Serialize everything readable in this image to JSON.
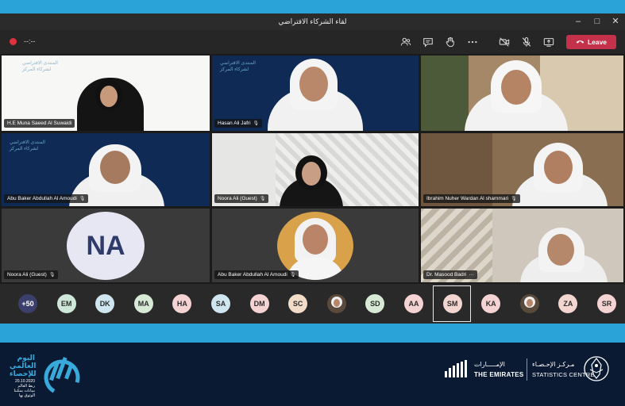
{
  "window": {
    "title": "لقاء الشركاء الافتراضي",
    "minimize": "–",
    "maximize": "□",
    "close": "✕"
  },
  "toolbar": {
    "timer": "--:--",
    "leave_label": "Leave"
  },
  "tiles": [
    {
      "name": "H.E Muna Saeed Al Suwaidi",
      "mic": false
    },
    {
      "name": "Hasan Ali Jafri",
      "mic": true
    },
    {
      "name": "",
      "mic": false
    },
    {
      "name": "Abu Baker Abdullah Al Amoudi",
      "mic": true
    },
    {
      "name": "Noora Ali (Guest)",
      "mic": true
    },
    {
      "name": "Ibrahim Nuher Wardan Al shammari",
      "mic": true
    },
    {
      "name": "Noora Ali (Guest)",
      "mic": true,
      "initials": "NA"
    },
    {
      "name": "Abu Baker Abdullah Al Amoudi",
      "mic": true
    },
    {
      "name": "Dr. Masood Badri",
      "more": "···"
    }
  ],
  "backdrop_text": {
    "line1": "المنتدى الافتراضي",
    "line2": "لشركاء المركز",
    "centre": "STATISTICS CENTRE"
  },
  "participants": [
    {
      "initials": "+50",
      "color": "#3b3f6b",
      "text_color": "#ffffff"
    },
    {
      "initials": "EM",
      "color": "#cde7d8"
    },
    {
      "initials": "DK",
      "color": "#cfe6f0"
    },
    {
      "initials": "MA",
      "color": "#d7ead6"
    },
    {
      "initials": "HA",
      "color": "#f6d3d3"
    },
    {
      "initials": "SA",
      "color": "#cfe6f0"
    },
    {
      "initials": "DM",
      "color": "#f6d3d3"
    },
    {
      "initials": "SC",
      "color": "#f3dcc8"
    },
    {
      "initials": "",
      "photo": true
    },
    {
      "initials": "SD",
      "color": "#d7ead6"
    },
    {
      "initials": "AA",
      "color": "#f6d3d3"
    },
    {
      "initials": "SM",
      "color": "#f3d6cf"
    },
    {
      "initials": "KA",
      "color": "#f6d3d3"
    },
    {
      "initials": "",
      "photo": true
    },
    {
      "initials": "ZA",
      "color": "#f3d6cf"
    },
    {
      "initials": "SR",
      "color": "#f6d3d3"
    }
  ],
  "footer": {
    "day_ar_1": "اليوم",
    "day_ar_2": "العالمي",
    "day_ar_3": "للإحصاء",
    "day_date": "20.10.2020",
    "day_sub_1": "ربط العالم",
    "day_sub_2": "ببيانات يمكننا",
    "day_sub_3": "الوثوق بها",
    "emirates_ar": "الإمـــــارات",
    "emirates_en": "THE EMIRATES",
    "centre_ar": "مـركـز الإحـصـاء",
    "centre_en": "STATISTICS CENTRE"
  },
  "colors": {
    "accent_blue": "#2aa3d8",
    "leave_red": "#c4314b",
    "footer_navy": "#0b1a33"
  }
}
